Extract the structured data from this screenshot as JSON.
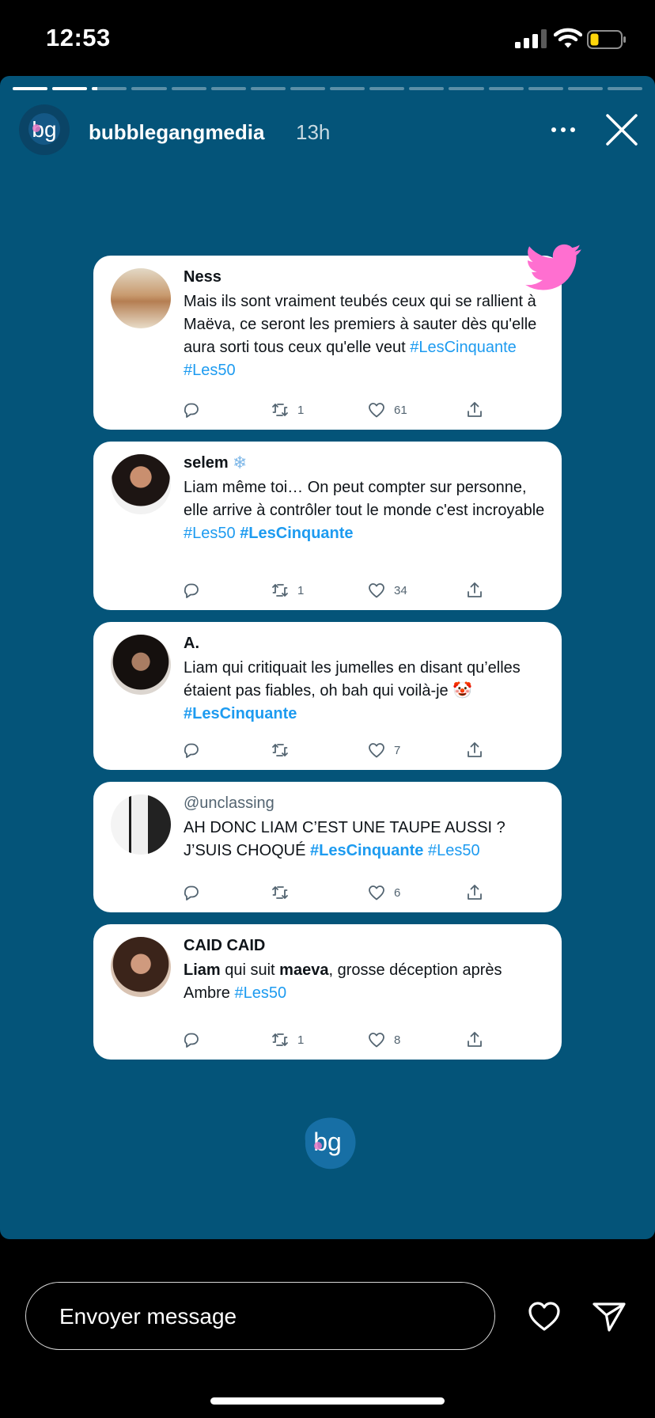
{
  "status_bar": {
    "time": "12:53",
    "battery_color": "#ffd60a",
    "icons": [
      "signal-icon",
      "wifi-icon",
      "battery-icon"
    ]
  },
  "story": {
    "username": "bubblegangmedia",
    "time_ago": "13h",
    "background_color": "#045479",
    "progress": {
      "segments": 16,
      "current_index": 2,
      "current_fraction": 0.15
    }
  },
  "tweets": [
    {
      "name": "Ness",
      "body": [
        {
          "text": "Mais ils sont vraiment teubés ceux qui se rallient à Maëva, ce seront les premiers à sauter dès qu'elle aura sorti tous ceux qu'elle veut "
        },
        {
          "text": "#LesCinquante",
          "type": "tag"
        },
        {
          "text": " "
        },
        {
          "text": "#Les50",
          "type": "tag"
        }
      ],
      "retweets": "1",
      "likes": "61"
    },
    {
      "name": "selem",
      "name_emoji": "❄",
      "body": [
        {
          "text": "Liam même toi… On peut compter sur personne, elle arrive à contrôler tout le monde c'est incroyable "
        },
        {
          "text": "#Les50",
          "type": "tag"
        },
        {
          "text": " "
        },
        {
          "text": "#LesCinquante",
          "type": "tag-bold"
        }
      ],
      "retweets": "1",
      "likes": "34"
    },
    {
      "name": "A.",
      "body": [
        {
          "text": "Liam qui critiquait les jumelles en disant qu’elles étaient pas fiables, oh bah qui voilà-je "
        },
        {
          "text": "🤡",
          "type": "emoji"
        },
        {
          "text": " "
        },
        {
          "text": "#LesCinquante",
          "type": "tag-bold"
        }
      ],
      "retweets": "",
      "likes": "7"
    },
    {
      "handle": "@unclassing",
      "body": [
        {
          "text": "AH DONC LIAM C’EST UNE TAUPE AUSSI ? J’SUIS CHOQUÉ "
        },
        {
          "text": "#LesCinquante",
          "type": "tag-bold"
        },
        {
          "text": " "
        },
        {
          "text": "#Les50",
          "type": "tag"
        }
      ],
      "retweets": "",
      "likes": "6"
    },
    {
      "name": "CAID CAID",
      "body": [
        {
          "text": "Liam",
          "type": "bold"
        },
        {
          "text": " qui suit "
        },
        {
          "text": "maeva",
          "type": "bold"
        },
        {
          "text": ", grosse déception après Ambre "
        },
        {
          "text": "#Les50",
          "type": "tag"
        }
      ],
      "retweets": "1",
      "likes": "8"
    }
  ],
  "colors": {
    "hashtag": "#1d9bf0",
    "twitter_bird": "#ff6fd0",
    "meta_text": "#536471"
  },
  "composer": {
    "placeholder": "Envoyer message"
  },
  "icons": {
    "tweet_actions": [
      "reply-icon",
      "retweet-icon",
      "like-icon",
      "share-icon"
    ],
    "story": [
      "more-icon",
      "close-icon",
      "heart-icon",
      "send-icon",
      "twitter-bird-icon",
      "bubblegang-logo"
    ]
  }
}
